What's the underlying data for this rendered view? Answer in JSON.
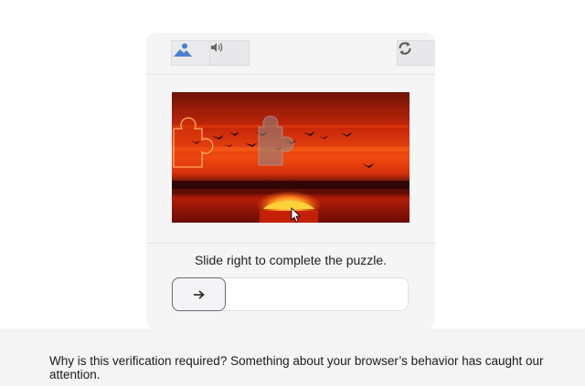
{
  "captcha": {
    "tabs": [
      {
        "name": "image-icon",
        "selected": true
      },
      {
        "name": "speaker-icon",
        "selected": false
      },
      {
        "name": "refresh-icon",
        "selected": false
      }
    ],
    "instruction": "Slide right to complete the puzzle.",
    "slider": {
      "icon": "arrow-right-icon",
      "progress": 0
    },
    "colors": {
      "accent": "#4a7fd4",
      "sky_top": "#7a1606",
      "sky_mid": "#e8360c",
      "sun": "#ffd23a"
    }
  },
  "footer": {
    "text": "Why is this verification required? Something about your browser’s behavior has caught our attention."
  }
}
